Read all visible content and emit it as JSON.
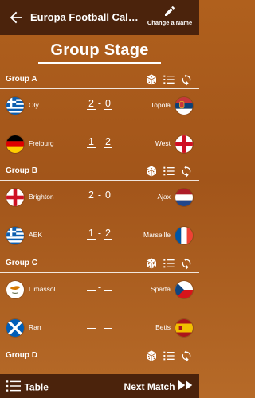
{
  "appbar": {
    "title": "Europa Football Calcula...",
    "change_name_label": "Change a Name"
  },
  "stage_title": "Group Stage",
  "groups": [
    {
      "name": "Group A",
      "matches": [
        {
          "home": "Oly",
          "home_flag": "greece-flag",
          "home_goals": "2",
          "away_goals": "0",
          "away": "Topola",
          "away_flag": "serbia-flag"
        },
        {
          "home": "Freiburg",
          "home_flag": "germany-flag",
          "home_goals": "1",
          "away_goals": "2",
          "away": "West",
          "away_flag": "england-flag"
        }
      ]
    },
    {
      "name": "Group B",
      "matches": [
        {
          "home": "Brighton",
          "home_flag": "england-flag",
          "home_goals": "2",
          "away_goals": "0",
          "away": "Ajax",
          "away_flag": "netherlands-flag"
        },
        {
          "home": "AEK",
          "home_flag": "greece-flag",
          "home_goals": "1",
          "away_goals": "2",
          "away": "Marseille",
          "away_flag": "france-flag"
        }
      ]
    },
    {
      "name": "Group C",
      "matches": [
        {
          "home": "Limassol",
          "home_flag": "cyprus-flag",
          "home_goals": "",
          "away_goals": "",
          "away": "Sparta",
          "away_flag": "czech-flag"
        },
        {
          "home": "Ran",
          "home_flag": "scotland-flag",
          "home_goals": "",
          "away_goals": "",
          "away": "Betis",
          "away_flag": "spain-flag"
        }
      ]
    },
    {
      "name": "Group D",
      "matches": []
    }
  ],
  "bottombar": {
    "table_label": "Table",
    "next_label": "Next Match"
  },
  "colors": {
    "background": "#a9591b",
    "bar": "#4b230c",
    "text": "#ffffff"
  },
  "icons": [
    "back-arrow-icon",
    "pencil-icon",
    "dice-icon",
    "list-icon",
    "refresh-icon",
    "table-list-icon",
    "fast-forward-icon"
  ]
}
